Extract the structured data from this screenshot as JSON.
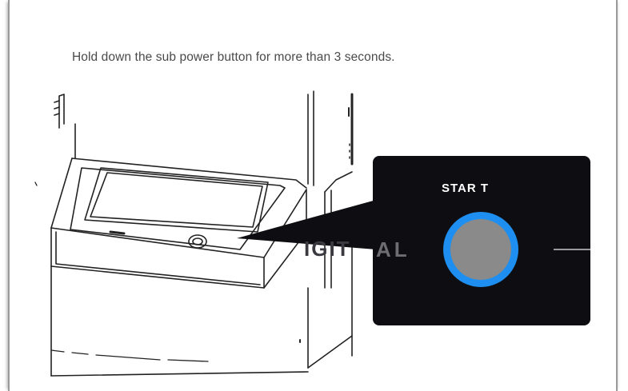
{
  "instruction": {
    "text": "Hold down the sub power button for more than 3 seconds."
  },
  "callout": {
    "button_label": "STAR T",
    "panel_text_fragment": "AL",
    "panel_background": "#0e0e12",
    "ring_color": "#1e8ff0",
    "button_fill": "#8a8a8a",
    "label_color": "#ffffff"
  },
  "icons": {
    "machine": "kiosk-machine-illustration",
    "button": "power-button-icon"
  }
}
